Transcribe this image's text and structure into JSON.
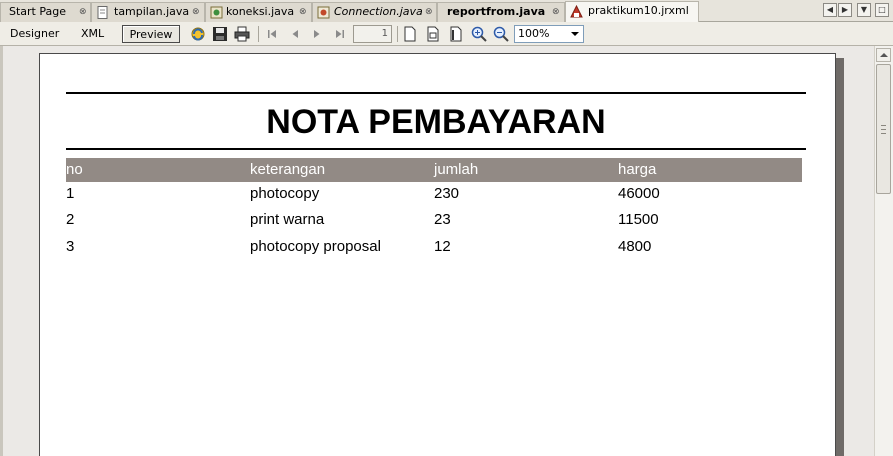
{
  "tabs": [
    {
      "label": "Start Page",
      "close": "x",
      "icon": "none"
    },
    {
      "label": "tampilan.java",
      "close": "x",
      "icon": "java-file"
    },
    {
      "label": "koneksi.java",
      "close": "x",
      "icon": "java-class"
    },
    {
      "label": "Connection.java",
      "close": "x",
      "icon": "java-class",
      "style": "italic"
    },
    {
      "label": "reportfrom.java",
      "close": "x",
      "icon": "none",
      "style": "bold"
    },
    {
      "label": "praktikum10.jrxml",
      "close": "",
      "icon": "jrxml-file",
      "active": true
    }
  ],
  "toolbar": {
    "designer_label": "Designer",
    "xml_label": "XML",
    "preview_label": "Preview",
    "page_number": "1",
    "zoom": "100%"
  },
  "report": {
    "title": "NOTA PEMBAYARAN",
    "header_color": "#928a85",
    "columns": [
      "no",
      "keterangan",
      "jumlah",
      "harga"
    ],
    "rows": [
      [
        "1",
        "photocopy",
        "230",
        "46000"
      ],
      [
        "2",
        "print warna",
        "23",
        "11500"
      ],
      [
        "3",
        "photocopy proposal",
        "12",
        "4800"
      ]
    ]
  }
}
